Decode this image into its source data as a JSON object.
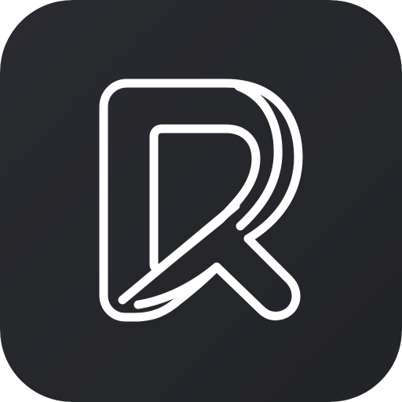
{
  "icon": {
    "name": "r-logo-icon",
    "background_color": "#222327",
    "background_color_light": "#2a2b30",
    "stroke_color": "#ffffff"
  }
}
